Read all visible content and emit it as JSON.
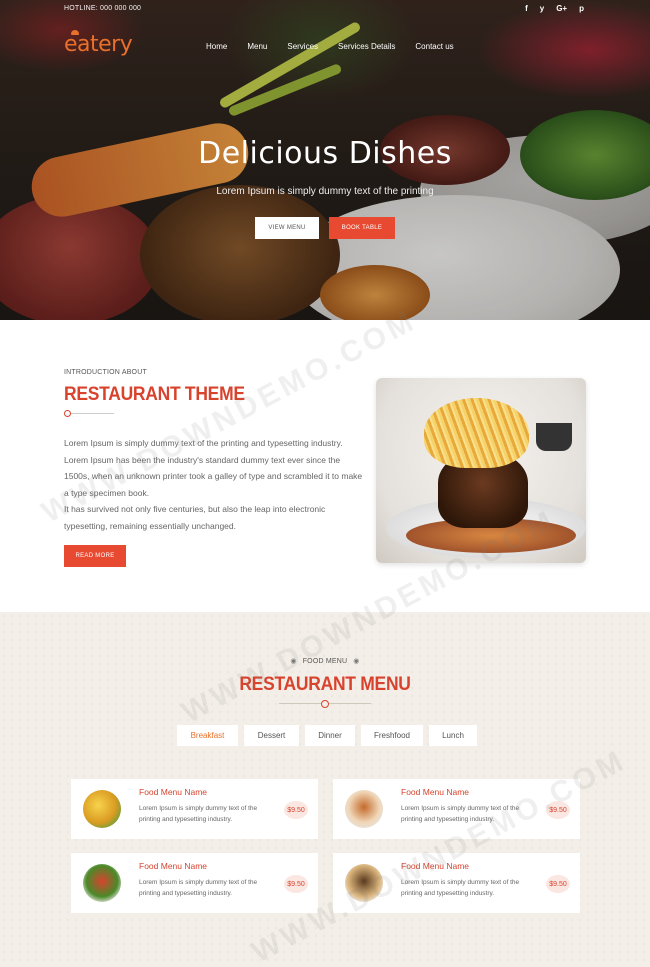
{
  "topbar": {
    "hotline": "HOTLINE: 000 000 000",
    "social_icons": [
      {
        "name": "facebook-icon",
        "glyph": "f"
      },
      {
        "name": "twitter-icon",
        "glyph": "y"
      },
      {
        "name": "google-plus-icon",
        "glyph": "G+"
      },
      {
        "name": "pinterest-icon",
        "glyph": "p"
      }
    ]
  },
  "brand": {
    "logo": "eatery",
    "accent": "#e8702a"
  },
  "nav": {
    "items": [
      "Home",
      "Menu",
      "Services",
      "Services Details",
      "Contact us"
    ]
  },
  "hero": {
    "title": "Delicious Dishes",
    "subtitle": "Lorem Ipsum is simply dummy text of the printing",
    "view_menu": "VIEW MENU",
    "book_table": "BOOK TABLE"
  },
  "intro": {
    "kicker": "INTRODUCTION ABOUT",
    "title": "RESTAURANT THEME",
    "body1": "Lorem Ipsum is simply dummy text of the printing and typesetting industry. Lorem Ipsum has been the industry's standard dummy text ever since the 1500s, when an unknown printer took a galley of type and scrambled it to make a type specimen book.",
    "body2": "It has survived not only five centuries, but also the leap into electronic typesetting, remaining essentially unchanged.",
    "read_more": "READ MORE"
  },
  "menu": {
    "kicker": "FOOD MENU",
    "title": "RESTAURANT MENU",
    "tabs": [
      "Breakfast",
      "Dessert",
      "Dinner",
      "Freshfood",
      "Lunch"
    ],
    "active_tab": "Breakfast",
    "items": [
      {
        "name": "Food Menu Name",
        "desc": "Lorem Ipsum is simply dummy text of the printing and typesetting industry.",
        "price": "$9.50"
      },
      {
        "name": "Food Menu Name",
        "desc": "Lorem Ipsum is simply dummy text of the printing and typesetting industry.",
        "price": "$9.50"
      },
      {
        "name": "Food Menu Name",
        "desc": "Lorem Ipsum is simply dummy text of the printing and typesetting industry.",
        "price": "$9.50"
      },
      {
        "name": "Food Menu Name",
        "desc": "Lorem Ipsum is simply dummy text of the printing and typesetting industry.",
        "price": "$9.50"
      }
    ]
  },
  "colors": {
    "accent_red": "#e84a31",
    "title_red": "#d8432e",
    "menu_bg": "#f3efe8"
  },
  "watermark": "WWW.DOWNDEMO.COM"
}
